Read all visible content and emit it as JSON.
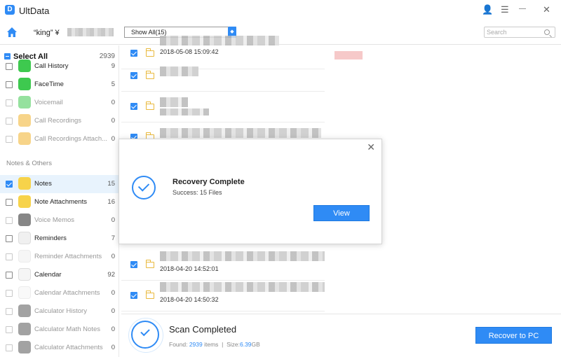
{
  "window": {
    "logo_letter": "D",
    "title": "UltData",
    "controls": {
      "user": "👤",
      "menu": "☰",
      "minimize": "—",
      "close": "✕"
    }
  },
  "toolbar": {
    "device_name": "“king” ¥",
    "filter_selected": "Show All(15)",
    "filter_arrow": "◆",
    "search_placeholder": "Search"
  },
  "sidebar": {
    "select_all_label": "Select All",
    "select_all_count": "2939",
    "section_notes_others": "Notes & Others",
    "items": [
      {
        "label": "Call History",
        "count": "9",
        "icon": "phone-icon",
        "color": "#3ec94f",
        "disabled": false,
        "checked": false
      },
      {
        "label": "FaceTime",
        "count": "5",
        "icon": "facetime-icon",
        "color": "#3ec94f",
        "disabled": false,
        "checked": false
      },
      {
        "label": "Voicemail",
        "count": "0",
        "icon": "voicemail-icon",
        "color": "#3ec94f",
        "disabled": true,
        "checked": false
      },
      {
        "label": "Call Recordings",
        "count": "0",
        "icon": "call-recording-icon",
        "color": "#f0b028",
        "disabled": true,
        "checked": false
      },
      {
        "label": "Call Recordings Attach...",
        "count": "0",
        "icon": "call-recording-attachment-icon",
        "color": "#f0b028",
        "disabled": true,
        "checked": false
      },
      {
        "label": "Notes",
        "count": "15",
        "icon": "notes-icon",
        "color": "#f7d34a",
        "disabled": false,
        "checked": true
      },
      {
        "label": "Note Attachments",
        "count": "16",
        "icon": "note-attachments-icon",
        "color": "#f7d34a",
        "disabled": false,
        "checked": false
      },
      {
        "label": "Voice Memos",
        "count": "0",
        "icon": "voice-memos-icon",
        "color": "#222222",
        "disabled": true,
        "checked": false
      },
      {
        "label": "Reminders",
        "count": "7",
        "icon": "reminders-icon",
        "color": "#f0f0f0",
        "disabled": false,
        "checked": false
      },
      {
        "label": "Reminder Attachments",
        "count": "0",
        "icon": "reminder-attachments-icon",
        "color": "#f0f0f0",
        "disabled": true,
        "checked": false
      },
      {
        "label": "Calendar",
        "count": "92",
        "icon": "calendar-icon",
        "color": "#f5f5f5",
        "disabled": false,
        "checked": false
      },
      {
        "label": "Calendar Attachments",
        "count": "0",
        "icon": "calendar-attachments-icon",
        "color": "#f5f5f5",
        "disabled": true,
        "checked": false
      },
      {
        "label": "Calculator History",
        "count": "0",
        "icon": "calculator-icon",
        "color": "#555555",
        "disabled": true,
        "checked": false
      },
      {
        "label": "Calculator Math Notes",
        "count": "0",
        "icon": "calculator-math-notes-icon",
        "color": "#555555",
        "disabled": true,
        "checked": false
      },
      {
        "label": "Calculator Attachments",
        "count": "0",
        "icon": "calculator-attachments-icon",
        "color": "#555555",
        "disabled": true,
        "checked": false
      }
    ]
  },
  "files": [
    {
      "date": "2018-05-08 15:09:42"
    },
    {
      "date": ""
    },
    {
      "date": ""
    },
    {
      "date": ""
    },
    {
      "date": "2018-04-20 14:52:01"
    },
    {
      "date": "2018-04-20 14:50:32"
    }
  ],
  "dialog": {
    "title": "Recovery Complete",
    "subtitle": "Success: 15 Files",
    "button": "View",
    "close": "✕"
  },
  "bottom": {
    "title": "Scan Completed",
    "found_prefix": "Found: ",
    "found_count": "2939",
    "found_suffix": " items",
    "size_prefix": "Size:",
    "size_value": "6.39",
    "size_unit": "GB",
    "recover_button": "Recover to PC"
  },
  "colors": {
    "accent": "#2f8bf5",
    "selected_row": "#e8f3fd",
    "folder": "#e9b93d"
  }
}
